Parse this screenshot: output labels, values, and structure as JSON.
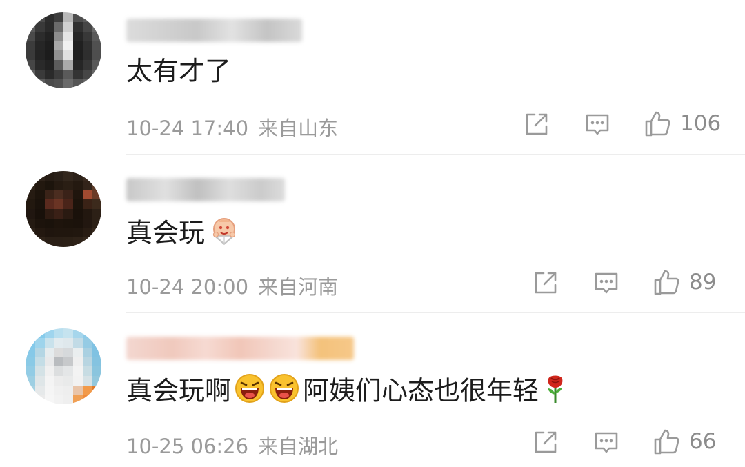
{
  "comments": [
    {
      "text": "太有才了",
      "date": "10-24 17:40",
      "location": "来自山东",
      "likes": "106",
      "avatar_style": "dark-mosaic"
    },
    {
      "text": "真会玩",
      "date": "10-24 20:00",
      "location": "来自河南",
      "likes": "89",
      "avatar_style": "brown-mosaic",
      "emoji": [
        "fan-pose-emoji"
      ]
    },
    {
      "text_before": "真会玩啊",
      "text_after": "阿姨们心态也很年轻",
      "date": "10-25 06:26",
      "location": "来自湖北",
      "likes": "66",
      "avatar_style": "light-blue-mosaic",
      "emoji": [
        "laughing-emoji",
        "laughing-emoji",
        "rose-emoji"
      ]
    }
  ],
  "icons": {
    "share": "share-icon",
    "reply": "comment-icon",
    "like": "thumbs-up-icon"
  },
  "colors": {
    "text": "#1c1c1c",
    "meta": "#9a9a9a",
    "icon": "#9a9a9a",
    "divider": "#ededed"
  }
}
